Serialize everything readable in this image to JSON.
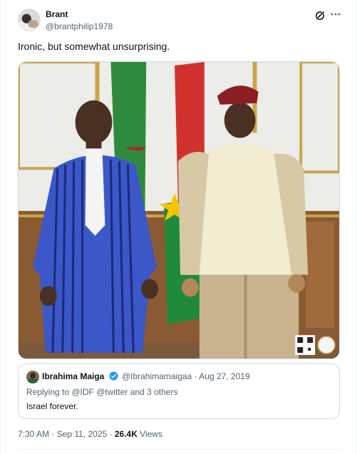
{
  "author": {
    "display_name": "Brant",
    "handle": "@brantphilip1978"
  },
  "tweet": {
    "text": "Ironic, but somewhat unsurprising."
  },
  "quoted_tweet": {
    "display_name": "Ibrahima Maiga",
    "handle_and_date": "@Ibrahimamaigaa · Aug 27, 2019",
    "replying_to": "Replying to @IDF @twitter and 3 others",
    "text": "Israel forever."
  },
  "footer": {
    "timestamp": "7:30 AM · Sep 11, 2025 ·",
    "views_count": "26.4K",
    "views_label": "Views"
  },
  "icons": {
    "grok": "grok-icon",
    "more": "more-icon",
    "verified": "verified-badge-icon"
  },
  "colors": {
    "text_primary": "#0f1419",
    "text_secondary": "#536471",
    "border": "#cfd9de",
    "verified_blue": "#1d9bf0"
  }
}
